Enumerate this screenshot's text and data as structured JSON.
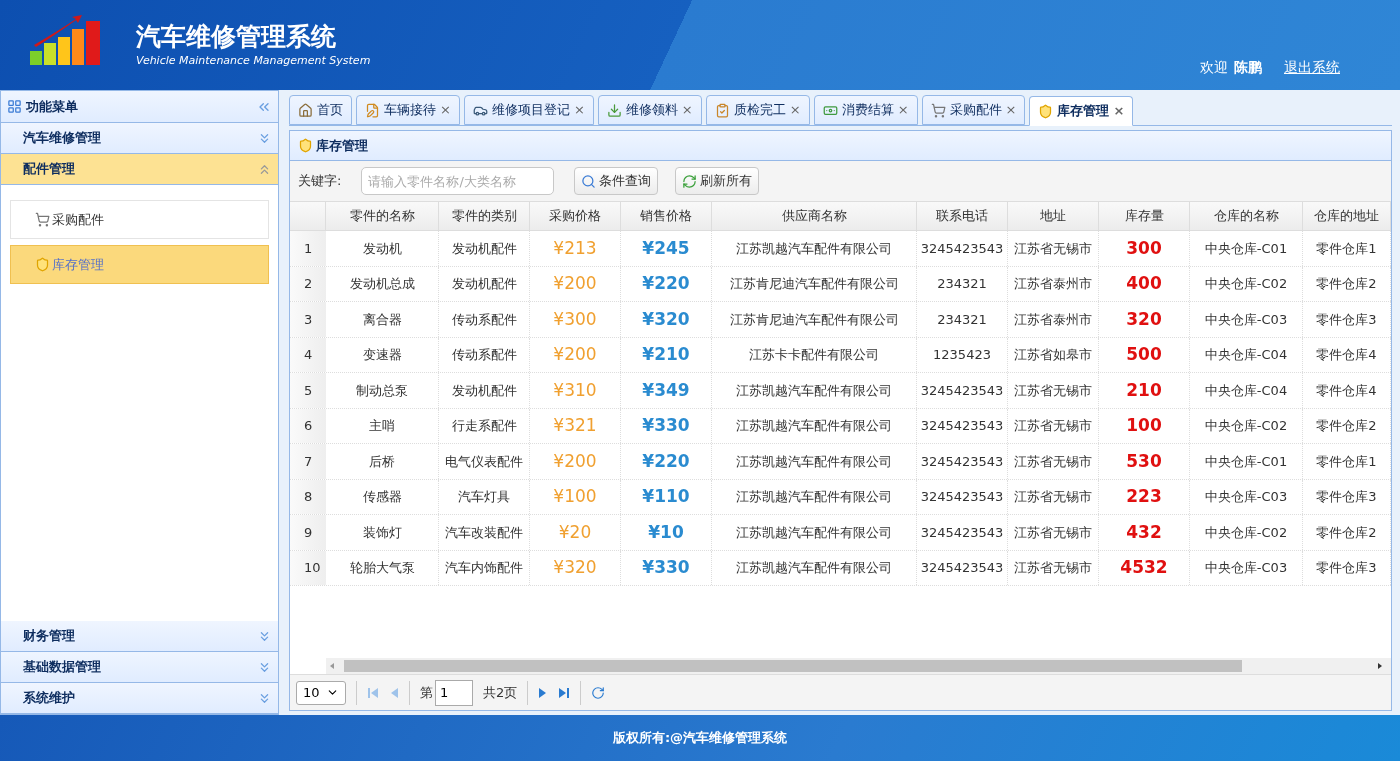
{
  "header": {
    "title": "汽车维修管理系统",
    "subtitle": "Vehicle Maintenance Management System",
    "welcome": "欢迎",
    "user": "陈鹏",
    "logout": "退出系统"
  },
  "sidebar": {
    "title": "功能菜单",
    "sections": [
      {
        "label": "汽车维修管理",
        "expanded": false
      },
      {
        "label": "配件管理",
        "expanded": true,
        "items": [
          {
            "label": "采购配件",
            "selected": false
          },
          {
            "label": "库存管理",
            "selected": true
          }
        ]
      },
      {
        "label": "财务管理",
        "expanded": false
      },
      {
        "label": "基础数据管理",
        "expanded": false
      },
      {
        "label": "系统维护",
        "expanded": false
      }
    ]
  },
  "tabs": [
    {
      "label": "首页",
      "selected": false
    },
    {
      "label": "车辆接待",
      "selected": false,
      "close": "×"
    },
    {
      "label": "维修项目登记",
      "selected": false,
      "close": "×"
    },
    {
      "label": "维修领料",
      "selected": false,
      "close": "×"
    },
    {
      "label": "质检完工",
      "selected": false,
      "close": "×"
    },
    {
      "label": "消费结算",
      "selected": false,
      "close": "×"
    },
    {
      "label": "采购配件",
      "selected": false,
      "close": "×"
    },
    {
      "label": "库存管理",
      "selected": true,
      "close": "×"
    }
  ],
  "panel": {
    "title": "库存管理",
    "keyword_label": "关键字:",
    "search_placeholder": "请输入零件名称/大类名称",
    "query_button": "条件查询",
    "refresh_button": "刷新所有"
  },
  "table": {
    "columns": [
      "零件的名称",
      "零件的类别",
      "采购价格",
      "销售价格",
      "供应商名称",
      "联系电话",
      "地址",
      "库存量",
      "仓库的名称",
      "仓库的地址"
    ],
    "rows": [
      {
        "index": "1",
        "cells": [
          "发动机",
          "发动机配件",
          "¥213",
          "¥245",
          "江苏凯越汽车配件有限公司",
          "3245423543",
          "江苏省无锡市",
          "300",
          "中央仓库-C01",
          "零件仓库1"
        ]
      },
      {
        "index": "2",
        "cells": [
          "发动机总成",
          "发动机配件",
          "¥200",
          "¥220",
          "江苏肯尼迪汽车配件有限公司",
          "234321",
          "江苏省泰州市",
          "400",
          "中央仓库-C02",
          "零件仓库2"
        ]
      },
      {
        "index": "3",
        "cells": [
          "离合器",
          "传动系配件",
          "¥300",
          "¥320",
          "江苏肯尼迪汽车配件有限公司",
          "234321",
          "江苏省泰州市",
          "320",
          "中央仓库-C03",
          "零件仓库3"
        ]
      },
      {
        "index": "4",
        "cells": [
          "变速器",
          "传动系配件",
          "¥200",
          "¥210",
          "江苏卡卡配件有限公司",
          "1235423",
          "江苏省如皋市",
          "500",
          "中央仓库-C04",
          "零件仓库4"
        ]
      },
      {
        "index": "5",
        "cells": [
          "制动总泵",
          "发动机配件",
          "¥310",
          "¥349",
          "江苏凯越汽车配件有限公司",
          "3245423543",
          "江苏省无锡市",
          "210",
          "中央仓库-C04",
          "零件仓库4"
        ]
      },
      {
        "index": "6",
        "cells": [
          "主哨",
          "行走系配件",
          "¥321",
          "¥330",
          "江苏凯越汽车配件有限公司",
          "3245423543",
          "江苏省无锡市",
          "100",
          "中央仓库-C02",
          "零件仓库2"
        ]
      },
      {
        "index": "7",
        "cells": [
          "后桥",
          "电气仪表配件",
          "¥200",
          "¥220",
          "江苏凯越汽车配件有限公司",
          "3245423543",
          "江苏省无锡市",
          "530",
          "中央仓库-C01",
          "零件仓库1"
        ]
      },
      {
        "index": "8",
        "cells": [
          "传感器",
          "汽车灯具",
          "¥100",
          "¥110",
          "江苏凯越汽车配件有限公司",
          "3245423543",
          "江苏省无锡市",
          "223",
          "中央仓库-C03",
          "零件仓库3"
        ]
      },
      {
        "index": "9",
        "cells": [
          "装饰灯",
          "汽车改装配件",
          "¥20",
          "¥10",
          "江苏凯越汽车配件有限公司",
          "3245423543",
          "江苏省无锡市",
          "432",
          "中央仓库-C02",
          "零件仓库2"
        ]
      },
      {
        "index": "10",
        "cells": [
          "轮胎大气泵",
          "汽车内饰配件",
          "¥320",
          "¥330",
          "江苏凯越汽车配件有限公司",
          "3245423543",
          "江苏省无锡市",
          "4532",
          "中央仓库-C03",
          "零件仓库3"
        ]
      }
    ]
  },
  "pager": {
    "page_size": "10",
    "page_prefix": "第",
    "page": "1",
    "total": "共2页"
  },
  "footer": "版权所有:@汽车维修管理系统"
}
